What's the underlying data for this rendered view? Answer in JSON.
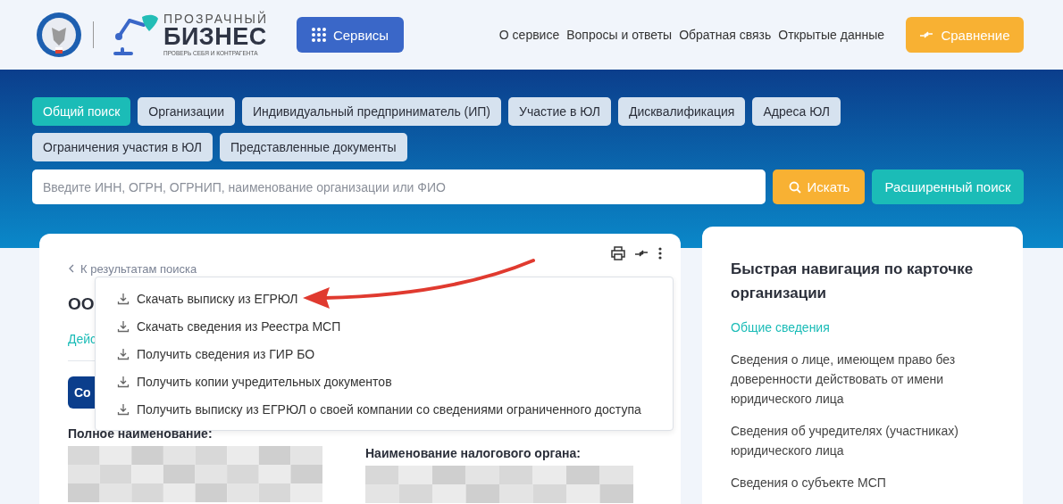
{
  "header": {
    "logo_lines": [
      "ПРОЗРАЧНЫЙ",
      "БИЗНЕС",
      "ПРОВЕРЬ СЕБЯ И КОНТРАГЕНТА"
    ],
    "services_button": "Сервисы",
    "nav_links": [
      "О сервисе",
      "Вопросы и ответы",
      "Обратная связь",
      "Открытые данные"
    ],
    "compare_button": "Сравнение"
  },
  "search_tabs": [
    {
      "label": "Общий поиск",
      "selected": true
    },
    {
      "label": "Организации",
      "selected": false
    },
    {
      "label": "Индивидуальный предприниматель (ИП)",
      "selected": false
    },
    {
      "label": "Участие в ЮЛ",
      "selected": false
    },
    {
      "label": "Дисквалификация",
      "selected": false
    },
    {
      "label": "Адреса ЮЛ",
      "selected": false
    },
    {
      "label": "Ограничения участия в ЮЛ",
      "selected": false
    },
    {
      "label": "Представленные документы",
      "selected": false
    }
  ],
  "search": {
    "placeholder": "Введите ИНН, ОГРН, ОГРНИП, наименование организации или ФИО",
    "search_button": "Искать",
    "advanced_button": "Расширенный поиск"
  },
  "card": {
    "back_link": "К результатам поиска",
    "org_name": "ОО",
    "status": "Дейс",
    "action_button": "Со",
    "fields": [
      {
        "label": "Полное наименование:"
      },
      {
        "label": "Наименование налогового органа:"
      }
    ]
  },
  "menu": {
    "items": [
      "Скачать выписку из ЕГРЮЛ",
      "Скачать сведения из Реестра МСП",
      "Получить сведения из ГИР БО",
      "Получить копии учредительных документов",
      "Получить выписку из ЕГРЮЛ о своей компании со сведениями ограниченного доступа"
    ]
  },
  "quick_nav": {
    "title": "Быстрая навигация по карточке организации",
    "items": [
      {
        "label": "Общие сведения",
        "selected": true
      },
      {
        "label": "Сведения о лице, имеющем право без доверенности действовать от имени юридического лица",
        "selected": false
      },
      {
        "label": "Сведения об учредителях (участниках) юридического лица",
        "selected": false
      },
      {
        "label": "Сведения о субъекте МСП",
        "selected": false
      }
    ]
  }
}
